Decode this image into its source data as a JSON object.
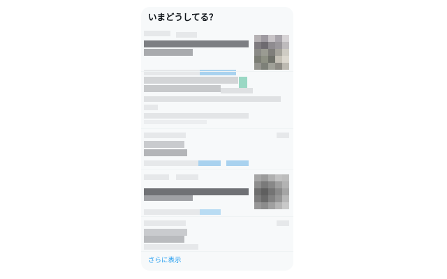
{
  "panel": {
    "title": "いまどうしてる？",
    "show_more_label": "さらに表示"
  },
  "trends": [
    {
      "kind": "news-with-image",
      "pixelated": true
    },
    {
      "kind": "news-text",
      "pixelated": true
    },
    {
      "kind": "trend-with-links",
      "pixelated": true
    },
    {
      "kind": "news-with-image",
      "pixelated": true
    },
    {
      "kind": "trend",
      "pixelated": true
    }
  ],
  "colors": {
    "panel_background": "#f7f9fa",
    "title_text": "#0f1419",
    "link_blue": "#1d9bf0",
    "blur_light": "#e6e8ea",
    "blur_mid": "#c9cbce",
    "blur_dark": "#6f7175",
    "blur_link": "#a9d2ef"
  }
}
